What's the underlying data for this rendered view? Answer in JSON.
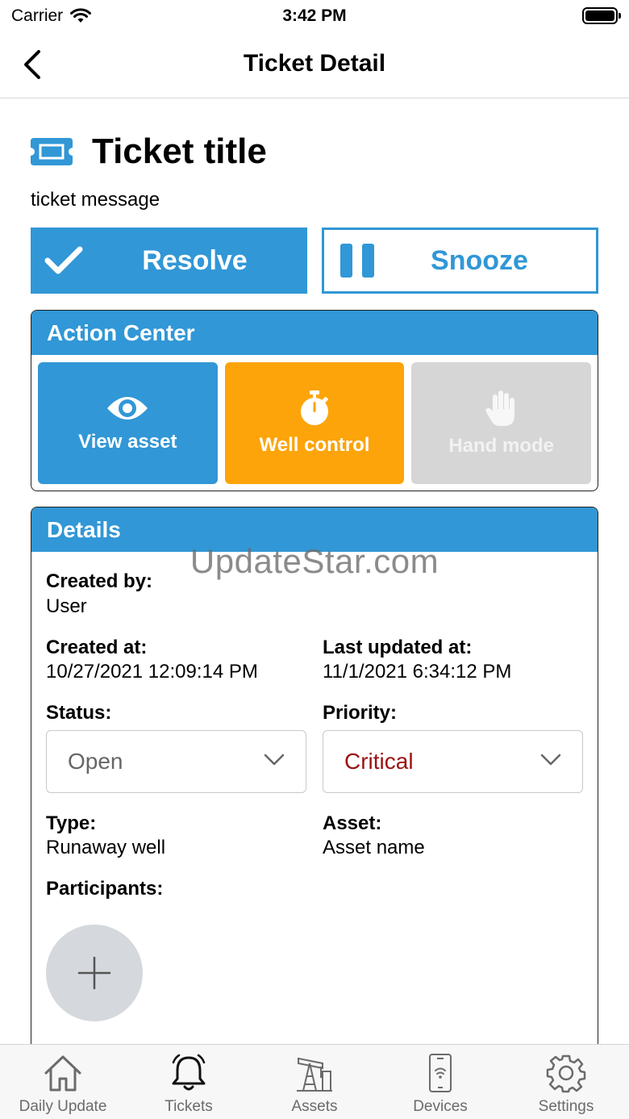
{
  "status_bar": {
    "carrier": "Carrier",
    "time": "3:42 PM"
  },
  "nav": {
    "title": "Ticket Detail"
  },
  "ticket": {
    "title": "Ticket title",
    "message": "ticket message"
  },
  "actions": {
    "resolve": "Resolve",
    "snooze": "Snooze"
  },
  "action_center": {
    "title": "Action Center",
    "tiles": [
      {
        "label": "View asset",
        "icon": "eye-icon",
        "enabled": true
      },
      {
        "label": "Well control",
        "icon": "stopwatch-icon",
        "enabled": true
      },
      {
        "label": "Hand mode",
        "icon": "hand-icon",
        "enabled": false
      }
    ]
  },
  "details": {
    "title": "Details",
    "created_by_label": "Created by:",
    "created_by": "User",
    "created_at_label": "Created at:",
    "created_at": "10/27/2021 12:09:14 PM",
    "last_updated_label": "Last updated at:",
    "last_updated": "11/1/2021 6:34:12 PM",
    "status_label": "Status:",
    "status": "Open",
    "priority_label": "Priority:",
    "priority": "Critical",
    "type_label": "Type:",
    "type": "Runaway well",
    "asset_label": "Asset:",
    "asset": "Asset name",
    "participants_label": "Participants:"
  },
  "watermark": "UpdateStar.com",
  "tabs": [
    {
      "label": "Daily Update",
      "icon": "house-icon"
    },
    {
      "label": "Tickets",
      "icon": "bell-icon",
      "active": true
    },
    {
      "label": "Assets",
      "icon": "oil-pump-icon"
    },
    {
      "label": "Devices",
      "icon": "phone-icon"
    },
    {
      "label": "Settings",
      "icon": "gear-icon"
    }
  ],
  "colors": {
    "primary": "#3197d6",
    "warning": "#fca40a",
    "disabled": "#d6d6d6",
    "critical": "#9b1111",
    "status_text": "#666666"
  }
}
